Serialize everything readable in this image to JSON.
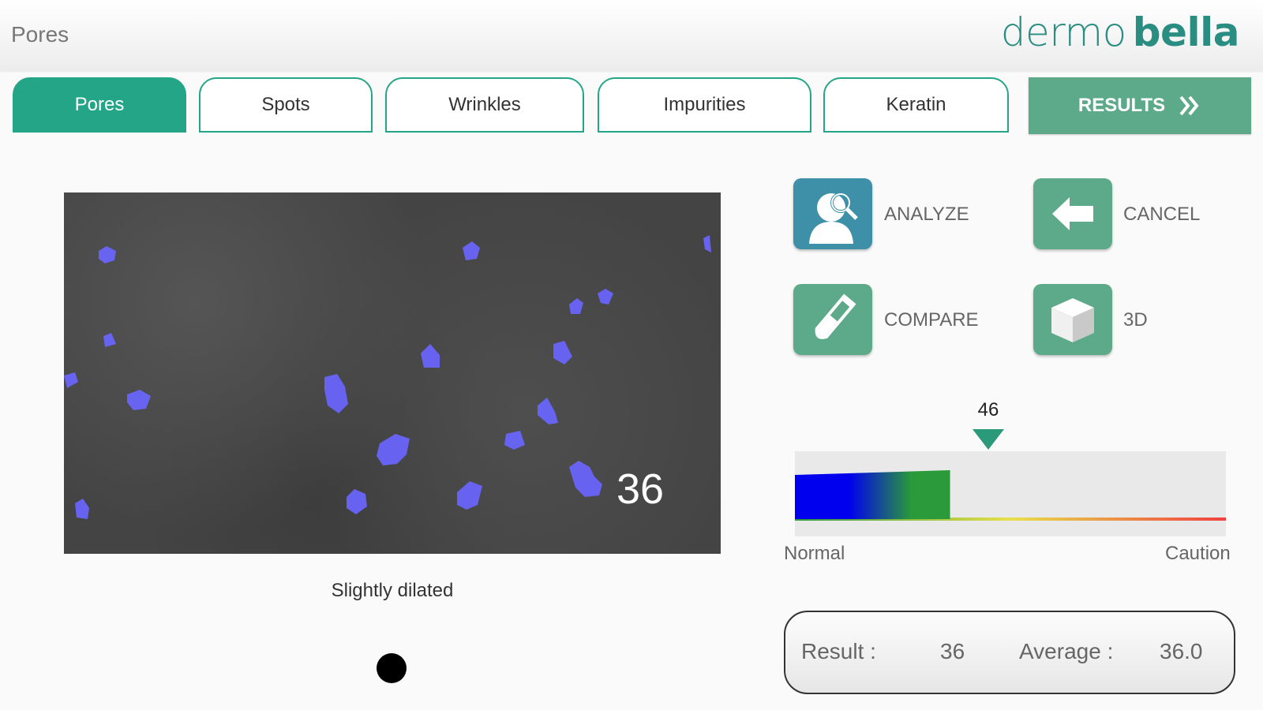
{
  "header": {
    "title": "Pores",
    "logo_primary": "dermo",
    "logo_secondary": "bella"
  },
  "tabs": [
    {
      "label": "Pores",
      "active": true
    },
    {
      "label": "Spots",
      "active": false
    },
    {
      "label": "Wrinkles",
      "active": false
    },
    {
      "label": "Impurities",
      "active": false
    },
    {
      "label": "Keratin",
      "active": false
    }
  ],
  "results_button": {
    "label": "RESULTS",
    "icon": "double-chevron-right-icon"
  },
  "image_panel": {
    "overlay_score": "36",
    "caption": "Slightly dilated"
  },
  "actions": {
    "analyze": {
      "label": "ANALYZE",
      "icon": "person-magnifier-icon",
      "color": "#3e8fa8"
    },
    "cancel": {
      "label": "CANCEL",
      "icon": "back-arrow-icon",
      "color": "#5daa8a"
    },
    "compare": {
      "label": "COMPARE",
      "icon": "test-tube-icon",
      "color": "#5daa8a"
    },
    "three_d": {
      "label": "3D",
      "icon": "cube-icon",
      "color": "#5daa8a"
    }
  },
  "gauge": {
    "value": "46",
    "fill_fraction": 0.36,
    "min_label": "Normal",
    "max_label": "Caution",
    "fill_colors": [
      "#0000ee",
      "#2a9a3a"
    ]
  },
  "summary": {
    "result_label": "Result :",
    "result_value": "36",
    "average_label": "Average :",
    "average_value": "36.0"
  },
  "colors": {
    "accent": "#25a587",
    "pore_overlay": "#6a66ff"
  }
}
